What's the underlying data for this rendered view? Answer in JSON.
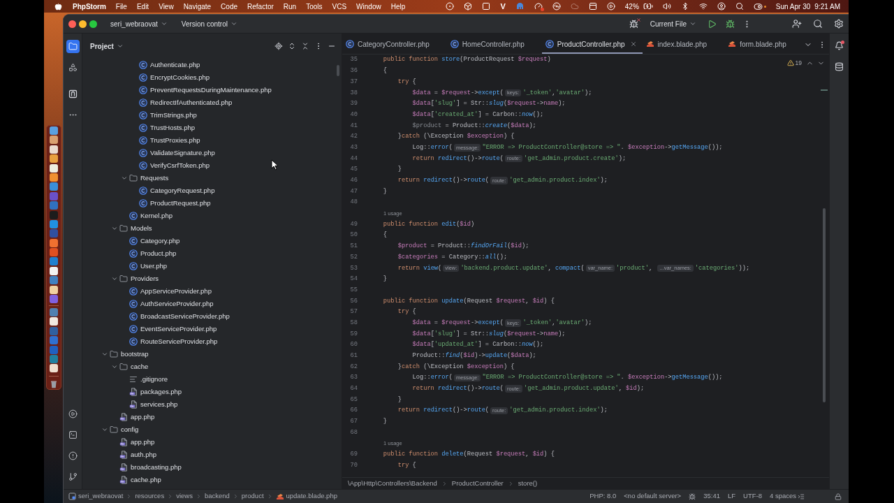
{
  "menu_bar": {
    "app_name": "PhpStorm",
    "menus": [
      "File",
      "Edit",
      "View",
      "Navigate",
      "Code",
      "Refactor",
      "Run",
      "Tools",
      "VCS",
      "Window",
      "Help"
    ],
    "status_letter": "V",
    "battery": "42%",
    "date": "Sun Apr 30",
    "time": "9:21 AM"
  },
  "title_bar": {
    "project": "seri_webraovat",
    "vcs": "Version control",
    "run_configuration": "Current File"
  },
  "left_toolbar": {
    "top": [
      {
        "selected": true
      },
      {
        "selected": false
      },
      {
        "selected": false
      },
      {
        "selected": false
      }
    ],
    "bottom": [
      {
        "selected": false
      },
      {
        "selected": false
      },
      {
        "selected": false
      },
      {
        "selected": false
      }
    ]
  },
  "project_panel": {
    "title": "Project",
    "tree": [
      {
        "children": [
          {
            "children": [
              {
                "children": [
                  {
                    "label": "Authenticate.php",
                    "kind": "class"
                  },
                  {
                    "label": "EncryptCookies.php",
                    "kind": "class"
                  },
                  {
                    "label": "PreventRequestsDuringMaintenance.php",
                    "kind": "class"
                  },
                  {
                    "label": "RedirectIfAuthenticated.php",
                    "kind": "class"
                  },
                  {
                    "label": "TrimStrings.php",
                    "kind": "class"
                  },
                  {
                    "label": "TrustHosts.php",
                    "kind": "class"
                  },
                  {
                    "label": "TrustProxies.php",
                    "kind": "class"
                  },
                  {
                    "label": "ValidateSignature.php",
                    "kind": "class"
                  },
                  {
                    "label": "VerifyCsrfToken.php",
                    "kind": "class"
                  }
                ]
              },
              {
                "label": "Requests",
                "kind": "folder",
                "expanded": true,
                "children": [
                  {
                    "label": "CategoryRequest.php",
                    "kind": "class"
                  },
                  {
                    "label": "ProductRequest.php",
                    "kind": "class"
                  }
                ]
              },
              {
                "label": "Kernel.php",
                "kind": "class"
              }
            ]
          },
          {
            "label": "Models",
            "kind": "folder",
            "expanded": true,
            "children": [
              {
                "label": "Category.php",
                "kind": "class"
              },
              {
                "label": "Product.php",
                "kind": "class"
              },
              {
                "label": "User.php",
                "kind": "class"
              }
            ]
          },
          {
            "label": "Providers",
            "kind": "folder",
            "expanded": true,
            "children": [
              {
                "label": "AppServiceProvider.php",
                "kind": "class"
              },
              {
                "label": "AuthServiceProvider.php",
                "kind": "class"
              },
              {
                "label": "BroadcastServiceProvider.php",
                "kind": "class"
              },
              {
                "label": "EventServiceProvider.php",
                "kind": "class"
              },
              {
                "label": "RouteServiceProvider.php",
                "kind": "class"
              }
            ]
          }
        ]
      },
      {
        "label": "bootstrap",
        "kind": "folder",
        "expanded": true,
        "children": [
          {
            "label": "cache",
            "kind": "folder",
            "expanded": true,
            "children": [
              {
                "label": ".gitignore",
                "kind": "text"
              },
              {
                "label": "packages.php",
                "kind": "php"
              },
              {
                "label": "services.php",
                "kind": "php"
              }
            ]
          },
          {
            "label": "app.php",
            "kind": "php"
          }
        ]
      },
      {
        "label": "config",
        "kind": "folder",
        "expanded": true,
        "children": [
          {
            "label": "app.php",
            "kind": "php"
          },
          {
            "label": "auth.php",
            "kind": "php"
          },
          {
            "label": "broadcasting.php",
            "kind": "php"
          },
          {
            "label": "cache.php",
            "kind": "php"
          }
        ]
      }
    ]
  },
  "editor": {
    "tabs": [
      {
        "label": "CategoryController.php",
        "kind": "class",
        "selected": false
      },
      {
        "label": "HomeController.php",
        "kind": "class",
        "selected": false
      },
      {
        "label": "ProductController.php",
        "kind": "class",
        "selected": true
      },
      {
        "label": "index.blade.php",
        "kind": "blade",
        "selected": false
      },
      {
        "label": "form.blade.php",
        "kind": "blade",
        "selected": false
      }
    ],
    "problems_count": "19",
    "lines": [
      {
        "kind": "line",
        "number": "35",
        "tokens": [
          {
            "kind": "keyword",
            "text": "    public function "
          },
          {
            "kind": "function",
            "text": "store"
          },
          {
            "kind": "plain",
            "text": "(ProductRequest "
          },
          {
            "kind": "variable",
            "text": "$request"
          },
          {
            "kind": "plain",
            "text": ")"
          }
        ]
      },
      {
        "kind": "line",
        "number": "36",
        "tokens": [
          {
            "kind": "plain",
            "text": "    {"
          }
        ]
      },
      {
        "kind": "line",
        "number": "37",
        "tokens": [
          {
            "kind": "keyword",
            "text": "        try"
          },
          {
            "kind": "plain",
            "text": " {"
          }
        ]
      },
      {
        "kind": "line",
        "number": "38",
        "tokens": [
          {
            "kind": "variable",
            "text": "            $data"
          },
          {
            "kind": "plain",
            "text": " = "
          },
          {
            "kind": "variable",
            "text": "$request"
          },
          {
            "kind": "plain",
            "text": "->"
          },
          {
            "kind": "function",
            "text": "except"
          },
          {
            "kind": "plain",
            "text": "("
          },
          {
            "kind": "hint",
            "text": "keys:"
          },
          {
            "kind": "string",
            "text": "'_token'"
          },
          {
            "kind": "plain",
            "text": ","
          },
          {
            "kind": "string",
            "text": "'avatar'"
          },
          {
            "kind": "plain",
            "text": ");"
          }
        ]
      },
      {
        "kind": "line",
        "number": "39",
        "tokens": [
          {
            "kind": "variable",
            "text": "            $data"
          },
          {
            "kind": "plain",
            "text": "["
          },
          {
            "kind": "string",
            "text": "'slug'"
          },
          {
            "kind": "plain",
            "text": "] = Str::"
          },
          {
            "kind": "static",
            "text": "slug"
          },
          {
            "kind": "plain",
            "text": "("
          },
          {
            "kind": "variable",
            "text": "$request"
          },
          {
            "kind": "plain",
            "text": "->"
          },
          {
            "kind": "field",
            "text": "name"
          },
          {
            "kind": "plain",
            "text": ");"
          }
        ]
      },
      {
        "kind": "line",
        "number": "40",
        "tokens": [
          {
            "kind": "variable",
            "text": "            $data"
          },
          {
            "kind": "plain",
            "text": "["
          },
          {
            "kind": "string",
            "text": "'created_at'"
          },
          {
            "kind": "plain",
            "text": "] = Carbon::"
          },
          {
            "kind": "static",
            "text": "now"
          },
          {
            "kind": "plain",
            "text": "();"
          }
        ]
      },
      {
        "kind": "line",
        "number": "41",
        "tokens": [
          {
            "kind": "unused",
            "text": "            $product"
          },
          {
            "kind": "plain",
            "text": " = Product::"
          },
          {
            "kind": "static",
            "text": "create"
          },
          {
            "kind": "plain",
            "text": "("
          },
          {
            "kind": "variable",
            "text": "$data"
          },
          {
            "kind": "plain",
            "text": ");"
          }
        ]
      },
      {
        "kind": "line",
        "number": "42",
        "tokens": [
          {
            "kind": "plain",
            "text": "        }"
          },
          {
            "kind": "keyword",
            "text": "catch"
          },
          {
            "kind": "plain",
            "text": " (\\Exception "
          },
          {
            "kind": "variable",
            "text": "$exception"
          },
          {
            "kind": "plain",
            "text": ") {"
          }
        ]
      },
      {
        "kind": "line",
        "number": "43",
        "tokens": [
          {
            "kind": "plain",
            "text": "            Log::"
          },
          {
            "kind": "function",
            "text": "error"
          },
          {
            "kind": "plain",
            "text": "("
          },
          {
            "kind": "hint",
            "text": "message:"
          },
          {
            "kind": "string",
            "text": "\"ERROR => ProductController@store => \""
          },
          {
            "kind": "plain",
            "text": ". "
          },
          {
            "kind": "variable",
            "text": "$exception"
          },
          {
            "kind": "plain",
            "text": "->"
          },
          {
            "kind": "function",
            "text": "getMessage"
          },
          {
            "kind": "plain",
            "text": "());"
          }
        ]
      },
      {
        "kind": "line",
        "number": "44",
        "tokens": [
          {
            "kind": "keyword",
            "text": "            return "
          },
          {
            "kind": "function",
            "text": "redirect"
          },
          {
            "kind": "plain",
            "text": "()->"
          },
          {
            "kind": "function",
            "text": "route"
          },
          {
            "kind": "plain",
            "text": "("
          },
          {
            "kind": "hint",
            "text": "route:"
          },
          {
            "kind": "string",
            "text": "'get_admin.product.create'"
          },
          {
            "kind": "plain",
            "text": ");"
          }
        ]
      },
      {
        "kind": "line",
        "number": "45",
        "tokens": [
          {
            "kind": "plain",
            "text": "        }"
          }
        ]
      },
      {
        "kind": "line",
        "number": "46",
        "tokens": [
          {
            "kind": "keyword",
            "text": "        return "
          },
          {
            "kind": "function",
            "text": "redirect"
          },
          {
            "kind": "plain",
            "text": "()->"
          },
          {
            "kind": "function",
            "text": "route"
          },
          {
            "kind": "plain",
            "text": "("
          },
          {
            "kind": "hint",
            "text": "route:"
          },
          {
            "kind": "string",
            "text": "'get_admin.product.index'"
          },
          {
            "kind": "plain",
            "text": ");"
          }
        ]
      },
      {
        "kind": "line",
        "number": "47",
        "tokens": [
          {
            "kind": "plain",
            "text": "    }"
          }
        ]
      },
      {
        "kind": "line",
        "number": "48"
      },
      {
        "kind": "usage",
        "text": "1 usage"
      },
      {
        "kind": "line",
        "number": "49",
        "tokens": [
          {
            "kind": "keyword",
            "text": "    public function "
          },
          {
            "kind": "function",
            "text": "edit"
          },
          {
            "kind": "plain",
            "text": "("
          },
          {
            "kind": "variable",
            "text": "$id"
          },
          {
            "kind": "plain",
            "text": ")"
          }
        ]
      },
      {
        "kind": "line",
        "number": "50",
        "tokens": [
          {
            "kind": "plain",
            "text": "    {"
          }
        ]
      },
      {
        "kind": "line",
        "number": "51",
        "tokens": [
          {
            "kind": "variable",
            "text": "        $product"
          },
          {
            "kind": "plain",
            "text": " = Product::"
          },
          {
            "kind": "static",
            "text": "findOrFail"
          },
          {
            "kind": "plain",
            "text": "("
          },
          {
            "kind": "variable",
            "text": "$id"
          },
          {
            "kind": "plain",
            "text": ");"
          }
        ]
      },
      {
        "kind": "line",
        "number": "52",
        "tokens": [
          {
            "kind": "variable",
            "text": "        $categories"
          },
          {
            "kind": "plain",
            "text": " = Category::"
          },
          {
            "kind": "static",
            "text": "all"
          },
          {
            "kind": "plain",
            "text": "();"
          }
        ]
      },
      {
        "kind": "line",
        "number": "53",
        "tokens": [
          {
            "kind": "keyword",
            "text": "        return "
          },
          {
            "kind": "function",
            "text": "view"
          },
          {
            "kind": "plain",
            "text": "("
          },
          {
            "kind": "hint",
            "text": "view:"
          },
          {
            "kind": "string",
            "text": "'backend.product.update'"
          },
          {
            "kind": "plain",
            "text": ", "
          },
          {
            "kind": "function",
            "text": "compact"
          },
          {
            "kind": "plain",
            "text": "("
          },
          {
            "kind": "hint",
            "text": "var_name:"
          },
          {
            "kind": "string",
            "text": "'product'"
          },
          {
            "kind": "plain",
            "text": ", "
          },
          {
            "kind": "hint",
            "text": "...var_names:"
          },
          {
            "kind": "string",
            "text": "'categories'"
          },
          {
            "kind": "plain",
            "text": "));"
          }
        ]
      },
      {
        "kind": "line",
        "number": "54",
        "tokens": [
          {
            "kind": "plain",
            "text": "    }"
          }
        ]
      },
      {
        "kind": "line",
        "number": "55"
      },
      {
        "kind": "line",
        "number": "56",
        "tokens": [
          {
            "kind": "keyword",
            "text": "    public function "
          },
          {
            "kind": "function",
            "text": "update"
          },
          {
            "kind": "plain",
            "text": "(Request "
          },
          {
            "kind": "variable",
            "text": "$request"
          },
          {
            "kind": "plain",
            "text": ", "
          },
          {
            "kind": "variable",
            "text": "$id"
          },
          {
            "kind": "plain",
            "text": ") {"
          }
        ]
      },
      {
        "kind": "line",
        "number": "57",
        "tokens": [
          {
            "kind": "keyword",
            "text": "        try"
          },
          {
            "kind": "plain",
            "text": " {"
          }
        ]
      },
      {
        "kind": "line",
        "number": "58",
        "tokens": [
          {
            "kind": "variable",
            "text": "            $data"
          },
          {
            "kind": "plain",
            "text": " = "
          },
          {
            "kind": "variable",
            "text": "$request"
          },
          {
            "kind": "plain",
            "text": "->"
          },
          {
            "kind": "function",
            "text": "except"
          },
          {
            "kind": "plain",
            "text": "("
          },
          {
            "kind": "hint",
            "text": "keys:"
          },
          {
            "kind": "string",
            "text": "'_token'"
          },
          {
            "kind": "plain",
            "text": ","
          },
          {
            "kind": "string",
            "text": "'avatar'"
          },
          {
            "kind": "plain",
            "text": ");"
          }
        ]
      },
      {
        "kind": "line",
        "number": "59",
        "tokens": [
          {
            "kind": "variable",
            "text": "            $data"
          },
          {
            "kind": "plain",
            "text": "["
          },
          {
            "kind": "string",
            "text": "'slug'"
          },
          {
            "kind": "plain",
            "text": "] = Str::"
          },
          {
            "kind": "static",
            "text": "slug"
          },
          {
            "kind": "plain",
            "text": "("
          },
          {
            "kind": "variable",
            "text": "$request"
          },
          {
            "kind": "plain",
            "text": "->"
          },
          {
            "kind": "field",
            "text": "name"
          },
          {
            "kind": "plain",
            "text": ");"
          }
        ]
      },
      {
        "kind": "line",
        "number": "60",
        "tokens": [
          {
            "kind": "variable",
            "text": "            $data"
          },
          {
            "kind": "plain",
            "text": "["
          },
          {
            "kind": "string",
            "text": "'updated_at'"
          },
          {
            "kind": "plain",
            "text": "] = Carbon::"
          },
          {
            "kind": "static",
            "text": "now"
          },
          {
            "kind": "plain",
            "text": "();"
          }
        ]
      },
      {
        "kind": "line",
        "number": "61",
        "tokens": [
          {
            "kind": "plain",
            "text": "            Product::"
          },
          {
            "kind": "static",
            "text": "find"
          },
          {
            "kind": "plain",
            "text": "("
          },
          {
            "kind": "variable",
            "text": "$id"
          },
          {
            "kind": "plain",
            "text": ")->"
          },
          {
            "kind": "function",
            "text": "update"
          },
          {
            "kind": "plain",
            "text": "("
          },
          {
            "kind": "variable",
            "text": "$data"
          },
          {
            "kind": "plain",
            "text": ");"
          }
        ]
      },
      {
        "kind": "line",
        "number": "62",
        "tokens": [
          {
            "kind": "plain",
            "text": "        }"
          },
          {
            "kind": "keyword",
            "text": "catch"
          },
          {
            "kind": "plain",
            "text": " (\\Exception "
          },
          {
            "kind": "variable",
            "text": "$exception"
          },
          {
            "kind": "plain",
            "text": ") {"
          }
        ]
      },
      {
        "kind": "line",
        "number": "63",
        "tokens": [
          {
            "kind": "plain",
            "text": "            Log::"
          },
          {
            "kind": "function",
            "text": "error"
          },
          {
            "kind": "plain",
            "text": "("
          },
          {
            "kind": "hint",
            "text": "message:"
          },
          {
            "kind": "string",
            "text": "\"ERROR => ProductController@store => \""
          },
          {
            "kind": "plain",
            "text": ". "
          },
          {
            "kind": "variable",
            "text": "$exception"
          },
          {
            "kind": "plain",
            "text": "->"
          },
          {
            "kind": "function",
            "text": "getMessage"
          },
          {
            "kind": "plain",
            "text": "());"
          }
        ]
      },
      {
        "kind": "line",
        "number": "64",
        "tokens": [
          {
            "kind": "keyword",
            "text": "            return "
          },
          {
            "kind": "function",
            "text": "redirect"
          },
          {
            "kind": "plain",
            "text": "()->"
          },
          {
            "kind": "function",
            "text": "route"
          },
          {
            "kind": "plain",
            "text": "("
          },
          {
            "kind": "hint",
            "text": "route:"
          },
          {
            "kind": "string",
            "text": "'get_admin.product.update'"
          },
          {
            "kind": "plain",
            "text": ", "
          },
          {
            "kind": "variable",
            "text": "$id"
          },
          {
            "kind": "plain",
            "text": ");"
          }
        ]
      },
      {
        "kind": "line",
        "number": "65",
        "tokens": [
          {
            "kind": "plain",
            "text": "        }"
          }
        ]
      },
      {
        "kind": "line",
        "number": "66",
        "tokens": [
          {
            "kind": "keyword",
            "text": "        return "
          },
          {
            "kind": "function",
            "text": "redirect"
          },
          {
            "kind": "plain",
            "text": "()->"
          },
          {
            "kind": "function",
            "text": "route"
          },
          {
            "kind": "plain",
            "text": "("
          },
          {
            "kind": "hint",
            "text": "route:"
          },
          {
            "kind": "string",
            "text": "'get_admin.product.index'"
          },
          {
            "kind": "plain",
            "text": ");"
          }
        ]
      },
      {
        "kind": "line",
        "number": "67",
        "tokens": [
          {
            "kind": "plain",
            "text": "    }"
          }
        ]
      },
      {
        "kind": "line",
        "number": "68"
      },
      {
        "kind": "usage",
        "text": "1 usage"
      },
      {
        "kind": "line",
        "number": "69",
        "tokens": [
          {
            "kind": "keyword",
            "text": "    public function "
          },
          {
            "kind": "function",
            "text": "delete"
          },
          {
            "kind": "plain",
            "text": "(Request "
          },
          {
            "kind": "variable",
            "text": "$request"
          },
          {
            "kind": "plain",
            "text": ", "
          },
          {
            "kind": "variable",
            "text": "$id"
          },
          {
            "kind": "plain",
            "text": ") {"
          }
        ]
      },
      {
        "kind": "line",
        "number": "70",
        "tokens": [
          {
            "kind": "keyword",
            "text": "        try"
          },
          {
            "kind": "plain",
            "text": " {"
          }
        ]
      }
    ],
    "breadcrumb": [
      "\\App\\Http\\Controllers\\Backend",
      "ProductController",
      "store()"
    ]
  },
  "status_bar": {
    "path": [
      {
        "label": "seri_webraovat",
        "kind": "project"
      },
      {
        "label": "resources",
        "kind": "folder"
      },
      {
        "label": "views",
        "kind": "folder"
      },
      {
        "label": "backend",
        "kind": "folder"
      },
      {
        "label": "product",
        "kind": "folder"
      },
      {
        "label": "update.blade.php",
        "kind": "blade"
      }
    ],
    "php_version": "PHP: 8.0",
    "server": "<no default server>",
    "caret_position": "35:41",
    "line_separator": "LF",
    "encoding": "UTF-8",
    "indent": "4 spaces"
  }
}
